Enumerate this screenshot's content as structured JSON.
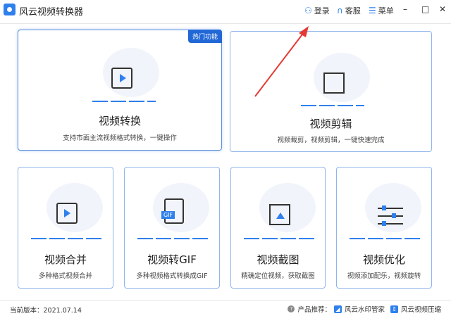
{
  "app": {
    "title": "风云视频转换器"
  },
  "titlebar": {
    "login": "登录",
    "service": "客服",
    "menu": "菜单"
  },
  "cards": [
    {
      "title": "视频转换",
      "desc": "支持市面主流视频格式转换，一键操作",
      "badge": "热门功能"
    },
    {
      "title": "视频剪辑",
      "desc": "视频裁剪，视频剪辑，一键快速完成"
    },
    {
      "title": "视频合并",
      "desc": "多种格式视频合并"
    },
    {
      "title": "视频转GIF",
      "desc": "多种视频格式转换成GIF",
      "icon_label": "GIF"
    },
    {
      "title": "视频截图",
      "desc": "精确定位视频，获取截图"
    },
    {
      "title": "视频优化",
      "desc": "视频添加配乐，视频旋转"
    }
  ],
  "footer": {
    "version": "当前版本：2021.07.14",
    "recommend": "产品推荐：",
    "products": [
      "风云水印管家",
      "风云视频压缩"
    ]
  },
  "colors": {
    "accent": "#2f80ed",
    "arrow": "#e53935"
  }
}
